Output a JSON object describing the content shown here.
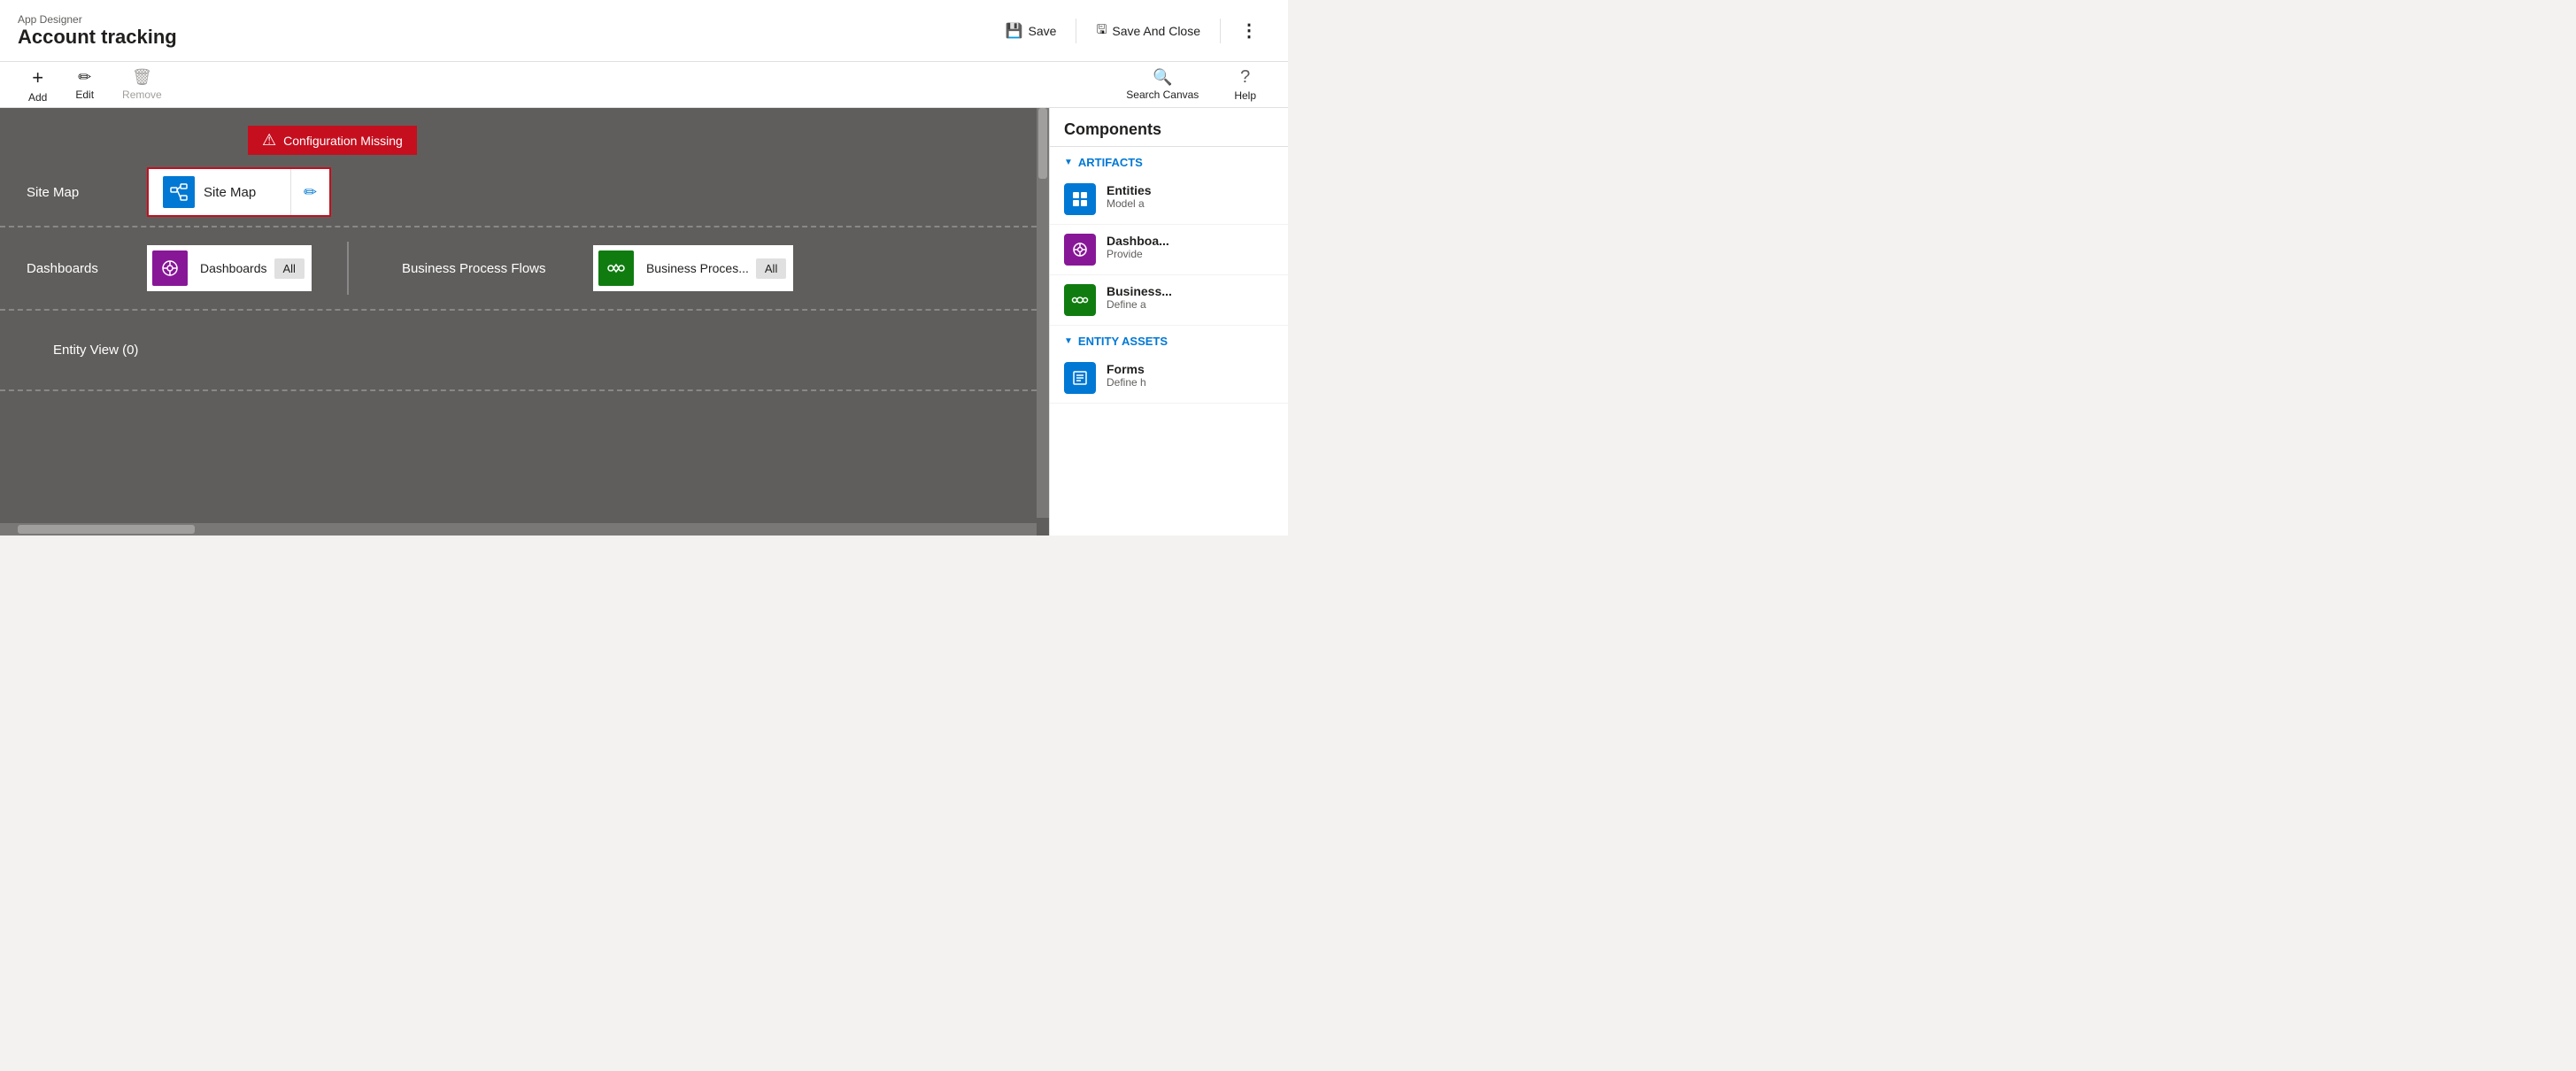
{
  "header": {
    "app_label": "App Designer",
    "title": "Account tracking",
    "save_label": "Save",
    "save_close_label": "Save And Close",
    "more_label": "..."
  },
  "toolbar": {
    "add_label": "Add",
    "edit_label": "Edit",
    "remove_label": "Remove",
    "search_canvas_label": "Search Canvas",
    "help_label": "Help"
  },
  "canvas": {
    "config_missing_text": "Configuration Missing",
    "site_map_label": "Site Map",
    "site_map_card_text": "Site Map",
    "dashboards_label": "Dashboards",
    "dashboards_card_text": "Dashboards",
    "dashboards_all": "All",
    "bpf_label": "Business Process Flows",
    "bpf_card_text": "Business Proces...",
    "bpf_all": "All",
    "entity_view_label": "Entity View (0)"
  },
  "components": {
    "panel_title": "Components",
    "artifacts_label": "ARTIFACTS",
    "entity_assets_label": "ENTITY ASSETS",
    "items": [
      {
        "name": "Entities",
        "desc": "Model a",
        "color": "#0078d4",
        "icon": "▦"
      },
      {
        "name": "Dashboa...",
        "desc": "Provide",
        "color": "#881798",
        "icon": "◎"
      },
      {
        "name": "Business...",
        "desc": "Define a",
        "color": "#107c10",
        "icon": "⇄"
      },
      {
        "name": "Forms",
        "desc": "Define h",
        "color": "#0078d4",
        "icon": "☰"
      }
    ]
  },
  "icons": {
    "save": "💾",
    "save_close": "🖫",
    "add": "+",
    "edit": "✏",
    "remove": "🗑",
    "search": "🔍",
    "help": "?",
    "warning": "⚠",
    "sitemap": "🗺",
    "dashboard": "◎",
    "bpf": "⇄",
    "edit_pencil": "✏",
    "chevron_down": "▼"
  }
}
